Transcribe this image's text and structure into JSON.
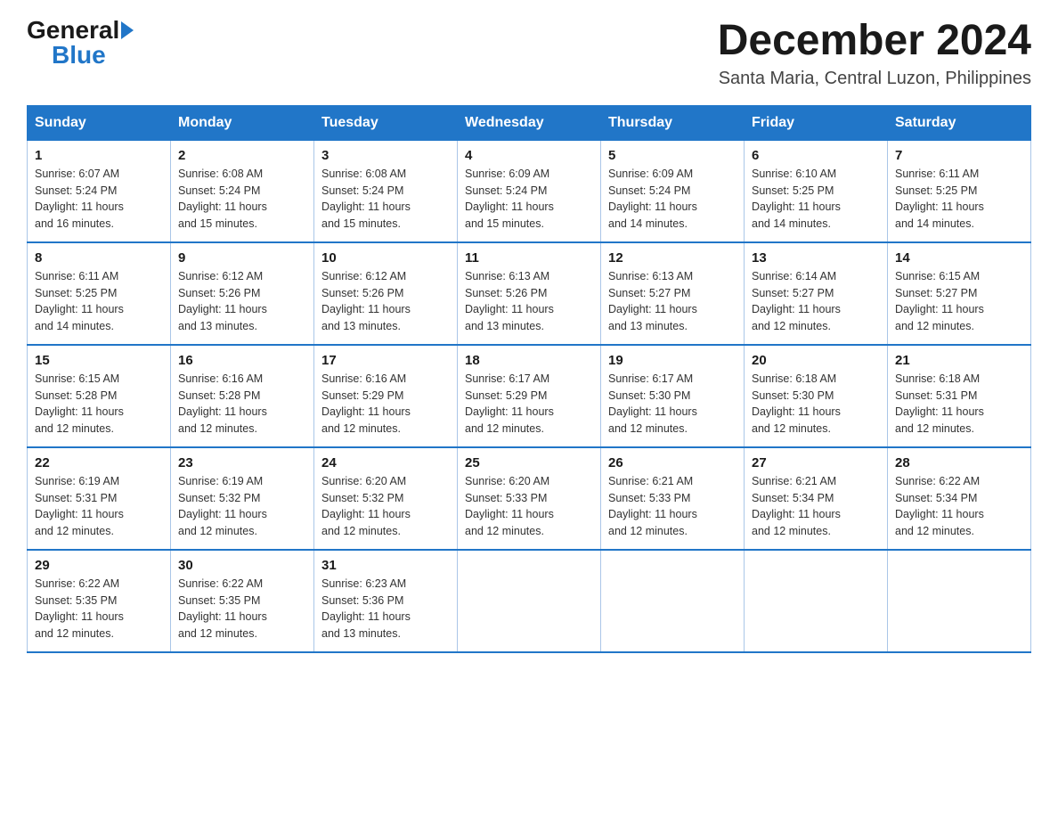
{
  "logo": {
    "general": "General",
    "blue": "Blue"
  },
  "header": {
    "month": "December 2024",
    "location": "Santa Maria, Central Luzon, Philippines"
  },
  "weekdays": [
    "Sunday",
    "Monday",
    "Tuesday",
    "Wednesday",
    "Thursday",
    "Friday",
    "Saturday"
  ],
  "weeks": [
    [
      {
        "day": "1",
        "sunrise": "6:07 AM",
        "sunset": "5:24 PM",
        "daylight": "11 hours and 16 minutes."
      },
      {
        "day": "2",
        "sunrise": "6:08 AM",
        "sunset": "5:24 PM",
        "daylight": "11 hours and 15 minutes."
      },
      {
        "day": "3",
        "sunrise": "6:08 AM",
        "sunset": "5:24 PM",
        "daylight": "11 hours and 15 minutes."
      },
      {
        "day": "4",
        "sunrise": "6:09 AM",
        "sunset": "5:24 PM",
        "daylight": "11 hours and 15 minutes."
      },
      {
        "day": "5",
        "sunrise": "6:09 AM",
        "sunset": "5:24 PM",
        "daylight": "11 hours and 14 minutes."
      },
      {
        "day": "6",
        "sunrise": "6:10 AM",
        "sunset": "5:25 PM",
        "daylight": "11 hours and 14 minutes."
      },
      {
        "day": "7",
        "sunrise": "6:11 AM",
        "sunset": "5:25 PM",
        "daylight": "11 hours and 14 minutes."
      }
    ],
    [
      {
        "day": "8",
        "sunrise": "6:11 AM",
        "sunset": "5:25 PM",
        "daylight": "11 hours and 14 minutes."
      },
      {
        "day": "9",
        "sunrise": "6:12 AM",
        "sunset": "5:26 PM",
        "daylight": "11 hours and 13 minutes."
      },
      {
        "day": "10",
        "sunrise": "6:12 AM",
        "sunset": "5:26 PM",
        "daylight": "11 hours and 13 minutes."
      },
      {
        "day": "11",
        "sunrise": "6:13 AM",
        "sunset": "5:26 PM",
        "daylight": "11 hours and 13 minutes."
      },
      {
        "day": "12",
        "sunrise": "6:13 AM",
        "sunset": "5:27 PM",
        "daylight": "11 hours and 13 minutes."
      },
      {
        "day": "13",
        "sunrise": "6:14 AM",
        "sunset": "5:27 PM",
        "daylight": "11 hours and 12 minutes."
      },
      {
        "day": "14",
        "sunrise": "6:15 AM",
        "sunset": "5:27 PM",
        "daylight": "11 hours and 12 minutes."
      }
    ],
    [
      {
        "day": "15",
        "sunrise": "6:15 AM",
        "sunset": "5:28 PM",
        "daylight": "11 hours and 12 minutes."
      },
      {
        "day": "16",
        "sunrise": "6:16 AM",
        "sunset": "5:28 PM",
        "daylight": "11 hours and 12 minutes."
      },
      {
        "day": "17",
        "sunrise": "6:16 AM",
        "sunset": "5:29 PM",
        "daylight": "11 hours and 12 minutes."
      },
      {
        "day": "18",
        "sunrise": "6:17 AM",
        "sunset": "5:29 PM",
        "daylight": "11 hours and 12 minutes."
      },
      {
        "day": "19",
        "sunrise": "6:17 AM",
        "sunset": "5:30 PM",
        "daylight": "11 hours and 12 minutes."
      },
      {
        "day": "20",
        "sunrise": "6:18 AM",
        "sunset": "5:30 PM",
        "daylight": "11 hours and 12 minutes."
      },
      {
        "day": "21",
        "sunrise": "6:18 AM",
        "sunset": "5:31 PM",
        "daylight": "11 hours and 12 minutes."
      }
    ],
    [
      {
        "day": "22",
        "sunrise": "6:19 AM",
        "sunset": "5:31 PM",
        "daylight": "11 hours and 12 minutes."
      },
      {
        "day": "23",
        "sunrise": "6:19 AM",
        "sunset": "5:32 PM",
        "daylight": "11 hours and 12 minutes."
      },
      {
        "day": "24",
        "sunrise": "6:20 AM",
        "sunset": "5:32 PM",
        "daylight": "11 hours and 12 minutes."
      },
      {
        "day": "25",
        "sunrise": "6:20 AM",
        "sunset": "5:33 PM",
        "daylight": "11 hours and 12 minutes."
      },
      {
        "day": "26",
        "sunrise": "6:21 AM",
        "sunset": "5:33 PM",
        "daylight": "11 hours and 12 minutes."
      },
      {
        "day": "27",
        "sunrise": "6:21 AM",
        "sunset": "5:34 PM",
        "daylight": "11 hours and 12 minutes."
      },
      {
        "day": "28",
        "sunrise": "6:22 AM",
        "sunset": "5:34 PM",
        "daylight": "11 hours and 12 minutes."
      }
    ],
    [
      {
        "day": "29",
        "sunrise": "6:22 AM",
        "sunset": "5:35 PM",
        "daylight": "11 hours and 12 minutes."
      },
      {
        "day": "30",
        "sunrise": "6:22 AM",
        "sunset": "5:35 PM",
        "daylight": "11 hours and 12 minutes."
      },
      {
        "day": "31",
        "sunrise": "6:23 AM",
        "sunset": "5:36 PM",
        "daylight": "11 hours and 13 minutes."
      },
      null,
      null,
      null,
      null
    ]
  ],
  "labels": {
    "sunrise_prefix": "Sunrise: ",
    "sunset_prefix": "Sunset: ",
    "daylight_prefix": "Daylight: "
  }
}
